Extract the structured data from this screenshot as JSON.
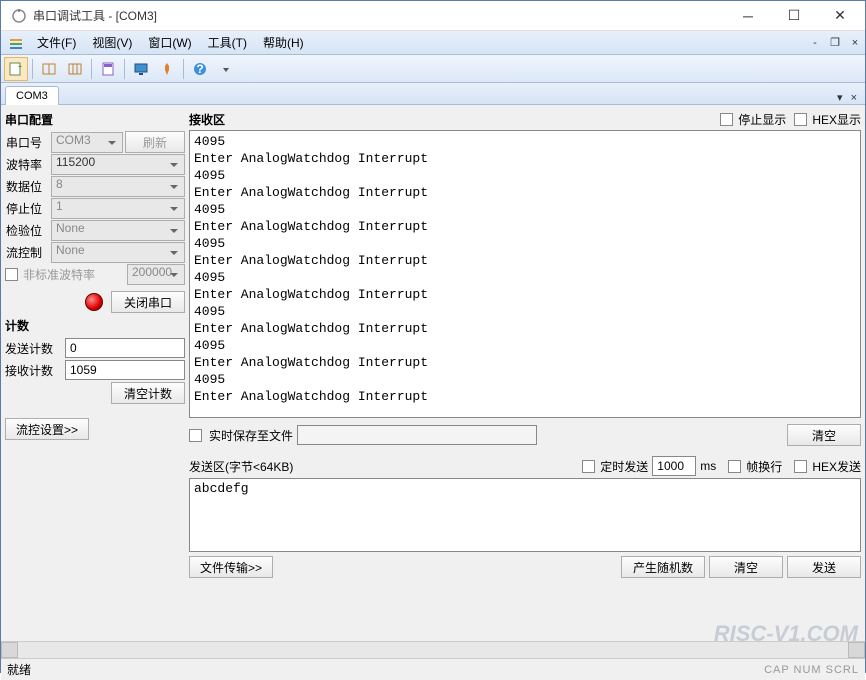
{
  "window": {
    "title": "串口调试工具 - [COM3]"
  },
  "menu": {
    "file": "文件(F)",
    "view": "视图(V)",
    "window": "窗口(W)",
    "tools": "工具(T)",
    "help": "帮助(H)"
  },
  "tab": {
    "name": "COM3"
  },
  "config": {
    "title": "串口配置",
    "port_label": "串口号",
    "port": "COM3",
    "refresh": "刷新",
    "baud_label": "波特率",
    "baud": "115200",
    "databits_label": "数据位",
    "databits": "8",
    "stopbits_label": "停止位",
    "stopbits": "1",
    "parity_label": "检验位",
    "parity": "None",
    "flow_label": "流控制",
    "flow": "None",
    "nonstd_label": "非标准波特率",
    "nonstd_val": "200000",
    "close_btn": "关闭串口",
    "count_title": "计数",
    "send_count_label": "发送计数",
    "send_count": "0",
    "recv_count_label": "接收计数",
    "recv_count": "1059",
    "clear_count": "清空计数",
    "flow_settings": "流控设置>>"
  },
  "recv": {
    "title": "接收区",
    "stop_display": "停止显示",
    "hex_display": "HEX显示",
    "lines": "4095\nEnter AnalogWatchdog Interrupt\n4095\nEnter AnalogWatchdog Interrupt\n4095\nEnter AnalogWatchdog Interrupt\n4095\nEnter AnalogWatchdog Interrupt\n4095\nEnter AnalogWatchdog Interrupt\n4095\nEnter AnalogWatchdog Interrupt\n4095\nEnter AnalogWatchdog Interrupt\n4095\nEnter AnalogWatchdog Interrupt",
    "save_label": "实时保存至文件",
    "clear_btn": "清空"
  },
  "send": {
    "title": "发送区(字节<64KB)",
    "timed_label": "定时发送",
    "timed_val": "1000",
    "timed_unit": "ms",
    "wrap_label": "帧换行",
    "hex_label": "HEX发送",
    "content": "abcdefg",
    "file_transfer": "文件传输>>",
    "random": "产生随机数",
    "clear": "清空",
    "send_btn": "发送"
  },
  "status": {
    "ready": "就绪",
    "indicators": "CAP  NUM  SCRL"
  },
  "watermark": "RISC-V1.COM"
}
